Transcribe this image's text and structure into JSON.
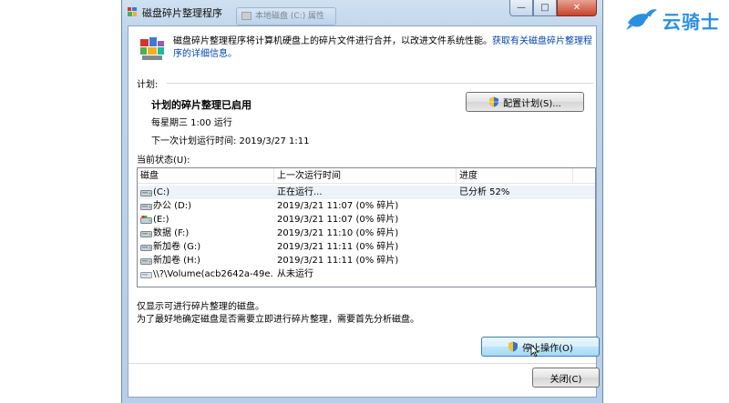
{
  "watermark": {
    "text": "云骑士",
    "color": "#2b8fe0"
  },
  "behind_window": {
    "title": "本地磁盘 (C:) 属性"
  },
  "window": {
    "title": "磁盘碎片整理程序",
    "controls": {
      "minimize": "—",
      "maximize": "□",
      "close": "✕"
    },
    "intro_text": "磁盘碎片整理程序将计算机硬盘上的碎片文件进行合并，以改进文件系统性能。",
    "intro_link": "获取有关磁盘碎片整理程序的详细信息。"
  },
  "schedule": {
    "section_label": "计划:",
    "status": "计划的碎片整理已启用",
    "frequency": "每星期三  1:00 运行",
    "next_run": "下一次计划运行时间: 2019/3/27 1:11",
    "configure_button": "配置计划(S)..."
  },
  "current_status": {
    "section_label": "当前状态(U):",
    "columns": [
      "磁盘",
      "上一次运行时间",
      "进度"
    ],
    "rows": [
      {
        "disk": "(C:)",
        "last_run": "正在运行...",
        "progress": "已分析 52%",
        "icon": "hard-drive-icon",
        "selected": true
      },
      {
        "disk": "办公 (D:)",
        "last_run": "2019/3/21 11:07 (0% 碎片)",
        "progress": "",
        "icon": "hard-drive-icon"
      },
      {
        "disk": "(E:)",
        "last_run": "2019/3/21 11:07 (0% 碎片)",
        "progress": "",
        "icon": "os-drive-icon"
      },
      {
        "disk": "数据 (F:)",
        "last_run": "2019/3/21 11:10 (0% 碎片)",
        "progress": "",
        "icon": "hard-drive-icon"
      },
      {
        "disk": "新加卷 (G:)",
        "last_run": "2019/3/21 11:11 (0% 碎片)",
        "progress": "",
        "icon": "hard-drive-icon"
      },
      {
        "disk": "新加卷 (H:)",
        "last_run": "2019/3/21 11:11 (0% 碎片)",
        "progress": "",
        "icon": "hard-drive-icon"
      },
      {
        "disk": "\\\\?\\Volume(acb2642a-49e...",
        "last_run": "从未运行",
        "progress": "",
        "icon": "volume-icon"
      }
    ]
  },
  "notes": {
    "line1": "仅显示可进行碎片整理的磁盘。",
    "line2": "为了最好地确定磁盘是否需要立即进行碎片整理，需要首先分析磁盘。"
  },
  "buttons": {
    "stop": "停止操作(O)",
    "close": "关闭(C)"
  }
}
